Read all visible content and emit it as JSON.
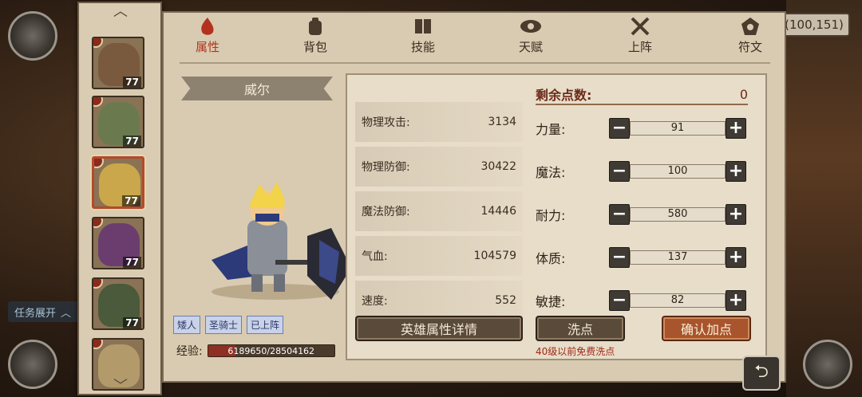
{
  "coords": "(100,151)",
  "task_expand": "任务展开",
  "tabs": [
    {
      "label": "属性",
      "icon": "flame-icon",
      "active": true
    },
    {
      "label": "背包",
      "icon": "backpack-icon",
      "active": false
    },
    {
      "label": "技能",
      "icon": "book-icon",
      "active": false
    },
    {
      "label": "天赋",
      "icon": "eye-icon",
      "active": false
    },
    {
      "label": "上阵",
      "icon": "crossed-swords-icon",
      "active": false
    },
    {
      "label": "符文",
      "icon": "rune-icon",
      "active": false
    }
  ],
  "heroes": [
    {
      "level": "77",
      "color": "#7a5a3e"
    },
    {
      "level": "77",
      "color": "#6a7a4e"
    },
    {
      "level": "77",
      "color": "#c9a74a",
      "selected": true
    },
    {
      "level": "77",
      "color": "#6b3d6e"
    },
    {
      "level": "77",
      "color": "#4a5a3a"
    },
    {
      "level": "",
      "color": "#b39a6a"
    }
  ],
  "hero": {
    "name": "威尔",
    "tags": [
      "矮人",
      "圣骑士",
      "已上阵"
    ],
    "exp_label": "经验:",
    "exp_text": "6189650/28504162",
    "exp_ratio": 0.217
  },
  "stats": [
    {
      "label": "物理攻击:",
      "value": "3134"
    },
    {
      "label": "物理防御:",
      "value": "30422"
    },
    {
      "label": "魔法防御:",
      "value": "14446"
    },
    {
      "label": "气血:",
      "value": "104579"
    },
    {
      "label": "速度:",
      "value": "552"
    }
  ],
  "remaining": {
    "label": "剩余点数:",
    "value": "0"
  },
  "attributes": [
    {
      "label": "力量:",
      "value": "91"
    },
    {
      "label": "魔法:",
      "value": "100"
    },
    {
      "label": "耐力:",
      "value": "580"
    },
    {
      "label": "体质:",
      "value": "137"
    },
    {
      "label": "敏捷:",
      "value": "82"
    }
  ],
  "buttons": {
    "detail": "英雄属性详情",
    "reset": "洗点",
    "confirm": "确认加点",
    "minus": "−",
    "plus": "+"
  },
  "free_note": "40级以前免费洗点"
}
